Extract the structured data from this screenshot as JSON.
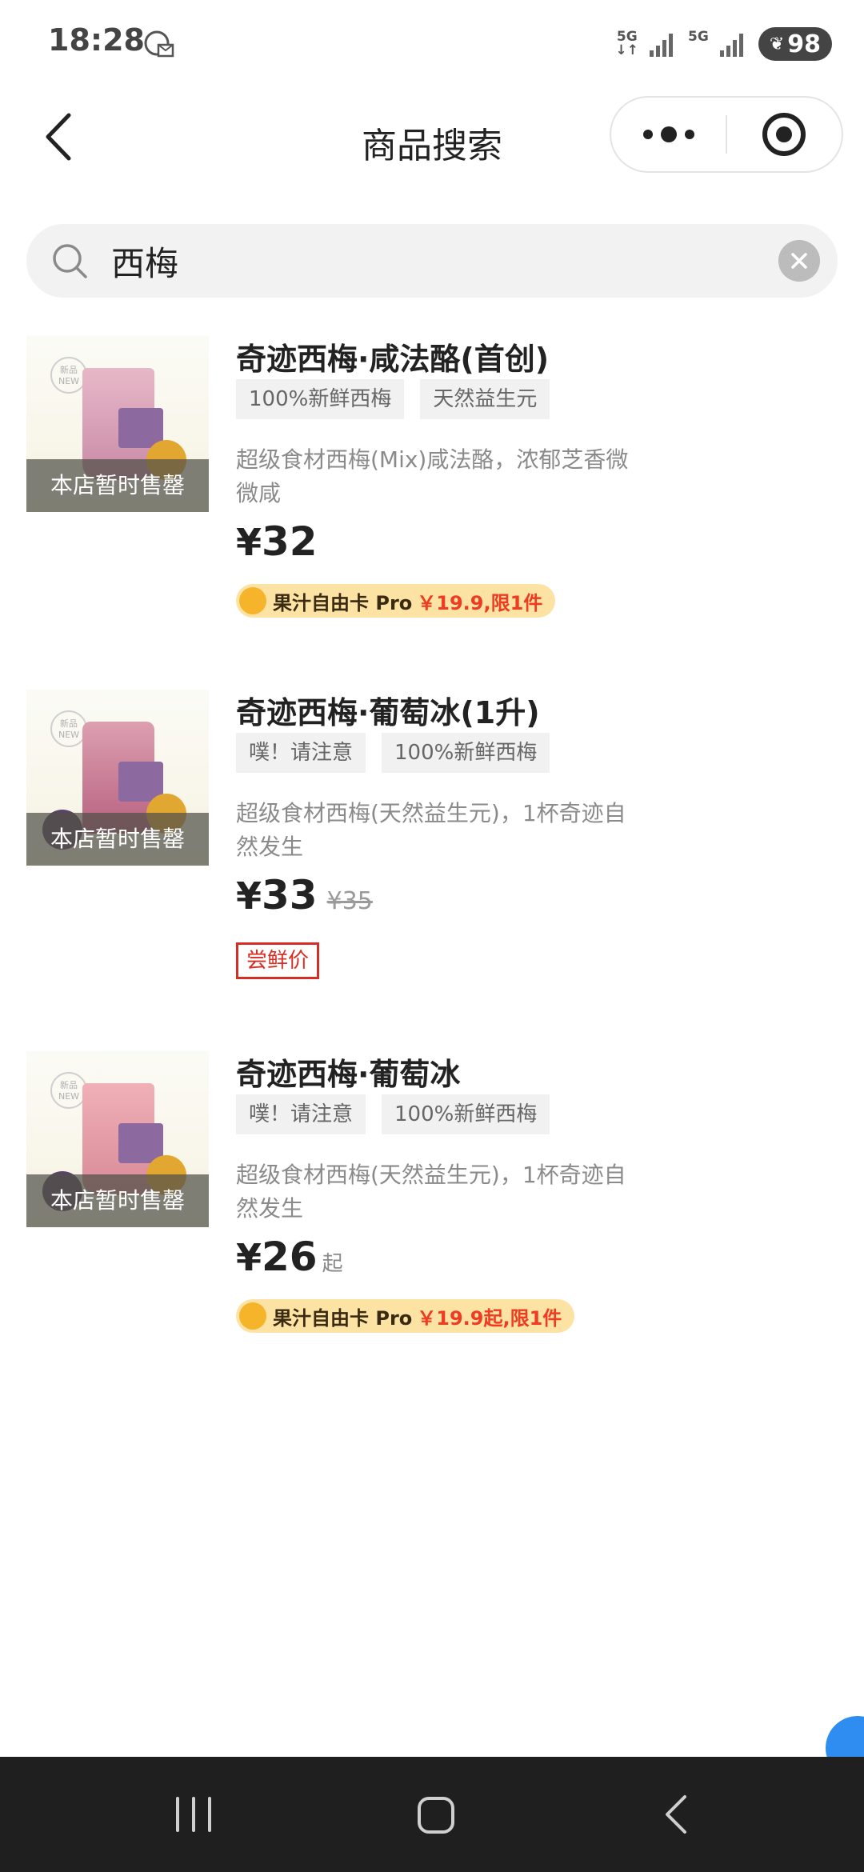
{
  "status_bar": {
    "time": "18:28",
    "network1": "5G",
    "network2": "5G",
    "battery": "98",
    "icons": [
      "notification-icon",
      "signal-icon",
      "battery-icon"
    ]
  },
  "nav": {
    "title": "商品搜索",
    "icons": [
      "back-arrow-icon",
      "more-dots-icon",
      "target-icon"
    ]
  },
  "search": {
    "value": "西梅",
    "icons": [
      "search-icon",
      "clear-icon"
    ]
  },
  "products": [
    {
      "title": "奇迹西梅·咸法酪(首创)",
      "tags": [
        "100%新鲜西梅",
        "天然益生元"
      ],
      "desc": "超级食材西梅(Mix)咸法酪，浓郁芝香微微咸",
      "status": "本店暂时售罄",
      "currency": "¥",
      "price": "32",
      "card_name": "果汁自由卡 Pro",
      "card_price": "￥19.9,限1件"
    },
    {
      "title": "奇迹西梅·葡萄冰(1升)",
      "tags": [
        "噗！请注意",
        "100%新鲜西梅"
      ],
      "desc": "超级食材西梅(天然益生元)，1杯奇迹自然发生",
      "status": "本店暂时售罄",
      "currency": "¥",
      "price": "33",
      "original_price": "¥35",
      "badge": "尝鲜价"
    },
    {
      "title": "奇迹西梅·葡萄冰",
      "tags": [
        "噗！请注意",
        "100%新鲜西梅"
      ],
      "desc": "超级食材西梅(天然益生元)，1杯奇迹自然发生",
      "status": "本店暂时售罄",
      "currency": "¥",
      "price": "26",
      "price_suffix": "起",
      "card_name": "果汁自由卡 Pro",
      "card_price": "￥19.9起,限1件"
    }
  ],
  "colors": {
    "accent_red": "#ef3b21",
    "badge_bg": "#fde3a3",
    "tasting_red": "#d52e24",
    "chat_blue": "#2f8cf0"
  },
  "system_nav": {
    "icons": [
      "recent-apps-icon",
      "home-icon",
      "back-icon"
    ]
  }
}
